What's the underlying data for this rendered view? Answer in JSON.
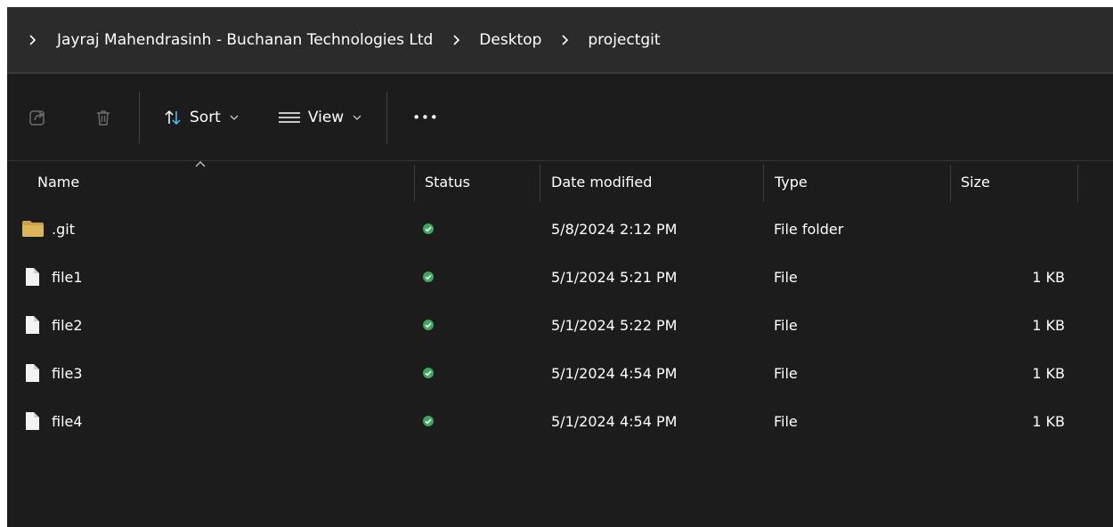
{
  "breadcrumb": {
    "items": [
      "Jayraj Mahendrasinh - Buchanan Technologies Ltd",
      "Desktop",
      "projectgit"
    ]
  },
  "toolbar": {
    "sort_label": "Sort",
    "view_label": "View",
    "more_label": "•••"
  },
  "columns": {
    "name": "Name",
    "status": "Status",
    "date_modified": "Date modified",
    "type": "Type",
    "size": "Size"
  },
  "files": [
    {
      "name": ".git",
      "kind": "folder-icon",
      "date": "5/8/2024 2:12 PM",
      "type": "File folder",
      "size": ""
    },
    {
      "name": "file1",
      "kind": "file-icon",
      "date": "5/1/2024 5:21 PM",
      "type": "File",
      "size": "1 KB"
    },
    {
      "name": "file2",
      "kind": "file-icon",
      "date": "5/1/2024 5:22 PM",
      "type": "File",
      "size": "1 KB"
    },
    {
      "name": "file3",
      "kind": "file-icon",
      "date": "5/1/2024 4:54 PM",
      "type": "File",
      "size": "1 KB"
    },
    {
      "name": "file4",
      "kind": "file-icon",
      "date": "5/1/2024 4:54 PM",
      "type": "File",
      "size": "1 KB"
    }
  ],
  "colors": {
    "background": "#1c1c1c",
    "addressbar": "#2b2b2b",
    "status_ok": "#3fa65d",
    "folder": "#c8a24a",
    "icon_dim": "#6d6d6d"
  }
}
